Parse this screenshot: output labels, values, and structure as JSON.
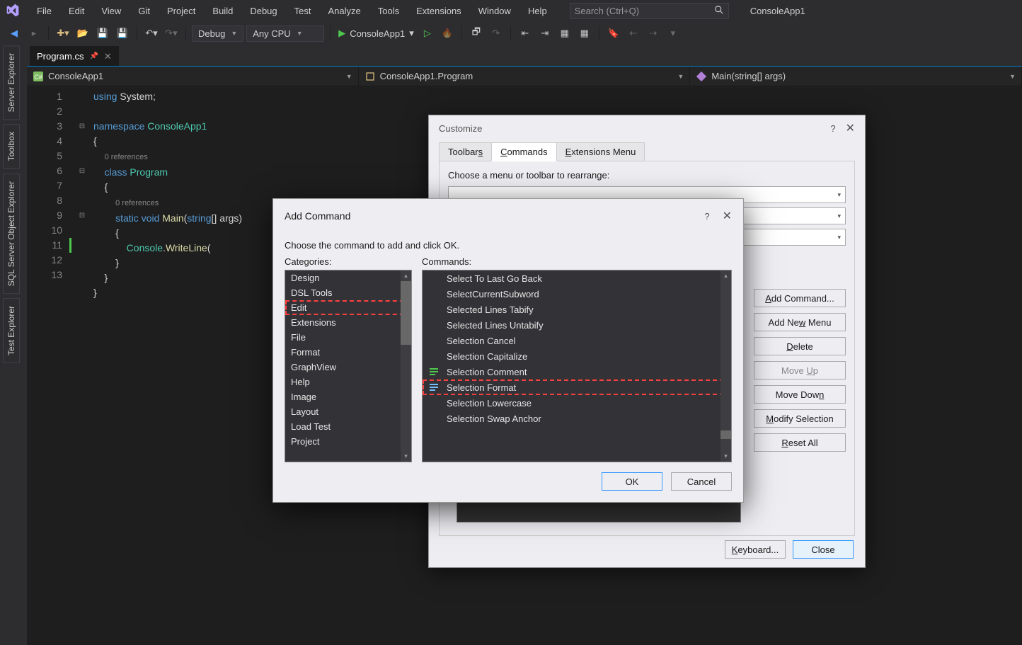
{
  "app": {
    "title": "ConsoleApp1"
  },
  "menu": {
    "items": [
      "File",
      "Edit",
      "View",
      "Git",
      "Project",
      "Build",
      "Debug",
      "Test",
      "Analyze",
      "Tools",
      "Extensions",
      "Window",
      "Help"
    ]
  },
  "search": {
    "placeholder": "Search (Ctrl+Q)"
  },
  "toolbar": {
    "config": "Debug",
    "platform": "Any CPU",
    "start": "ConsoleApp1"
  },
  "side_tabs": [
    "Server Explorer",
    "Toolbox",
    "SQL Server Object Explorer",
    "Test Explorer"
  ],
  "document": {
    "tab": "Program.cs",
    "nav1": "ConsoleApp1",
    "nav2": "ConsoleApp1.Program",
    "nav3": "Main(string[] args)"
  },
  "code": {
    "line_count": 13,
    "l1a": "using ",
    "l1b": "System;",
    "l3a": "namespace ",
    "l3b": "ConsoleApp1",
    "l4": "{",
    "ref0": "0 references",
    "l5a": "    class ",
    "l5b": "Program",
    "l6": "    {",
    "ref1": "0 references",
    "l7a": "        static ",
    "l7b": "void ",
    "l7c": "Main",
    "l7d": "(",
    "l7e": "string",
    "l7f": "[] args)",
    "l8": "        {",
    "l9a": "            Console",
    "l9b": ".",
    "l9c": "WriteLine",
    "l9d": "(",
    "l10": "        }",
    "l11": "    }",
    "l12": "}"
  },
  "customize": {
    "title": "Customize",
    "tabs": [
      "Toolbars",
      "Commands",
      "Extensions Menu"
    ],
    "prompt": "Choose a menu or toolbar to rearrange:",
    "buttons": {
      "add_command": "Add Command...",
      "add_menu": "Add New Menu",
      "delete": "Delete",
      "move_up": "Move Up",
      "move_down": "Move Down",
      "modify": "Modify Selection",
      "reset": "Reset All",
      "keyboard": "Keyboard...",
      "close": "Close"
    }
  },
  "add_command": {
    "title": "Add Command",
    "instruction": "Choose the command to add and click OK.",
    "categories_label": "Categories:",
    "commands_label": "Commands:",
    "ok": "OK",
    "cancel": "Cancel",
    "categories": [
      "Design",
      "DSL Tools",
      "Edit",
      "Extensions",
      "File",
      "Format",
      "GraphView",
      "Help",
      "Image",
      "Layout",
      "Load Test",
      "Project"
    ],
    "selected_category": "Edit",
    "commands": [
      "Select To Last Go Back",
      "SelectCurrentSubword",
      "Selected Lines Tabify",
      "Selected Lines Untabify",
      "Selection Cancel",
      "Selection Capitalize",
      "Selection Comment",
      "Selection Format",
      "Selection Lowercase",
      "Selection Swap Anchor"
    ],
    "selected_command": "Selection Format"
  }
}
